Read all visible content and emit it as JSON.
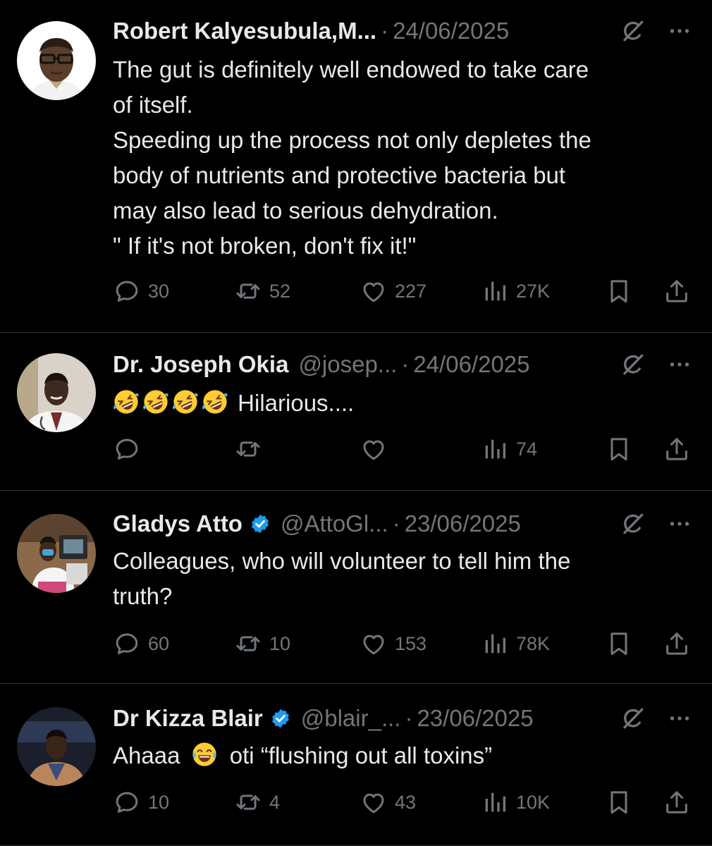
{
  "tweets": [
    {
      "name": "Robert Kalyesubula,M...",
      "handle": "",
      "date": "24/06/2025",
      "verified": false,
      "lines": [
        "The gut is definitely well endowed to take care",
        "of itself.",
        "Speeding up the process not only depletes the",
        "body of nutrients and protective bacteria but",
        "may also lead to serious dehydration.",
        "\" If it's not broken, don't fix it!\""
      ],
      "replies": "30",
      "reposts": "52",
      "likes": "227",
      "views": "27K"
    },
    {
      "name": "Dr. Joseph Okia",
      "handle": "@josep...",
      "date": "24/06/2025",
      "verified": false,
      "emojis": [
        "rolling-on-floor-laughing",
        "rolling-on-floor-laughing",
        "rolling-on-floor-laughing",
        "rolling-on-floor-laughing"
      ],
      "text": "Hilarious....",
      "replies": "",
      "reposts": "",
      "likes": "",
      "views": "74"
    },
    {
      "name": "Gladys Atto",
      "handle": "@AttoGl...",
      "date": "23/06/2025",
      "verified": true,
      "lines": [
        "Colleagues, who will volunteer to tell him the",
        "truth?"
      ],
      "replies": "60",
      "reposts": "10",
      "likes": "153",
      "views": "78K"
    },
    {
      "name": "Dr Kizza Blair",
      "handle": "@blair_...",
      "date": "23/06/2025",
      "verified": true,
      "text_before": "Ahaaa",
      "emoji": "face-with-tears-of-joy",
      "text_after": "oti “flushing out all toxins”",
      "replies": "10",
      "reposts": "4",
      "likes": "43",
      "views": "10K"
    }
  ],
  "separator": "·",
  "colors": {
    "background": "#000000",
    "text": "#e7e9ea",
    "muted": "#71767b",
    "verified": "#1d9bf0",
    "divider": "#2f3336"
  }
}
